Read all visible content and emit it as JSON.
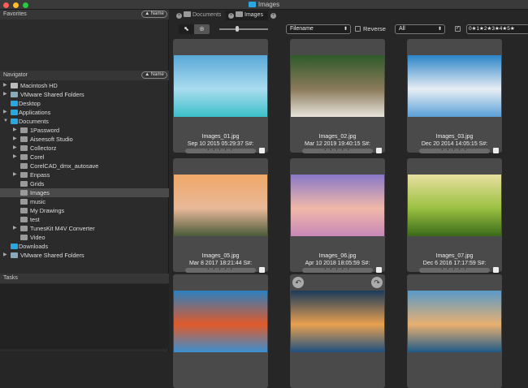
{
  "window": {
    "title": "Images"
  },
  "favorites": {
    "title": "Favorites",
    "sort_label": "▲ Name"
  },
  "navigator": {
    "title": "Navigator",
    "sort_label": "▲ Name",
    "items": [
      {
        "label": "Macintosh HD",
        "level": 0,
        "expander": true,
        "icon": "disk"
      },
      {
        "label": "VMware Shared Folders",
        "level": 0,
        "expander": true,
        "icon": "network"
      },
      {
        "label": "Desktop",
        "level": 0,
        "expander": false,
        "icon": "blue"
      },
      {
        "label": "Applications",
        "level": 0,
        "expander": true,
        "icon": "blue"
      },
      {
        "label": "Documents",
        "level": 0,
        "expander": true,
        "open": true,
        "icon": "blue"
      },
      {
        "label": "1Password",
        "level": 1,
        "expander": true,
        "icon": "gray"
      },
      {
        "label": "Aiseesoft Studio",
        "level": 1,
        "expander": true,
        "icon": "gray"
      },
      {
        "label": "Collectorz",
        "level": 1,
        "expander": true,
        "icon": "gray"
      },
      {
        "label": "Corel",
        "level": 1,
        "expander": true,
        "icon": "gray"
      },
      {
        "label": "CorelCAD_dmx_autosave",
        "level": 1,
        "expander": false,
        "icon": "gray"
      },
      {
        "label": "Enpass",
        "level": 1,
        "expander": true,
        "icon": "gray"
      },
      {
        "label": "Grids",
        "level": 1,
        "expander": false,
        "icon": "gray"
      },
      {
        "label": "Images",
        "level": 1,
        "expander": false,
        "icon": "gray",
        "selected": true
      },
      {
        "label": "music",
        "level": 1,
        "expander": false,
        "icon": "gray"
      },
      {
        "label": "My Drawings",
        "level": 1,
        "expander": false,
        "icon": "gray"
      },
      {
        "label": "test",
        "level": 1,
        "expander": false,
        "icon": "gray"
      },
      {
        "label": "TunesKit M4V Converter",
        "level": 1,
        "expander": true,
        "icon": "gray"
      },
      {
        "label": "Video",
        "level": 1,
        "expander": false,
        "icon": "gray"
      },
      {
        "label": "Downloads",
        "level": 0,
        "expander": false,
        "icon": "blue"
      },
      {
        "label": "VMware Shared Folders",
        "level": 0,
        "expander": true,
        "icon": "network"
      }
    ]
  },
  "tasks": {
    "title": "Tasks"
  },
  "tabs": [
    {
      "label": "Documents",
      "active": false
    },
    {
      "label": "Images",
      "active": true
    }
  ],
  "toolbar": {
    "sort_field": "Filename",
    "reverse_label": "Reverse",
    "filter": "All",
    "rating_filter": "0★1★2★3★4★5★"
  },
  "thumbnails": [
    {
      "name": "Images_01.jpg",
      "date": "Sep 10 2015 05:29:37 S#:",
      "rating": "• • • • •",
      "colors": [
        "#5aa8d8",
        "#a9dcef",
        "#3cc0c8"
      ]
    },
    {
      "name": "Images_02.jpg",
      "date": "Mar 12 2019 19:40:15 S#:",
      "rating": "• • • • •",
      "colors": [
        "#2f5a2a",
        "#8a7a5a",
        "#e8e4dc"
      ]
    },
    {
      "name": "Images_03.jpg",
      "date": "Dec 20 2014 14:05:15 S#:",
      "rating": "• • • • •",
      "colors": [
        "#2a84c8",
        "#e8eef4",
        "#5aa0d8"
      ]
    },
    {
      "name": "Images_05.jpg",
      "date": "Mar 8 2017 18:21:44 S#:",
      "rating": "• • • • •",
      "colors": [
        "#f0a868",
        "#e8b898",
        "#4a5a3a"
      ]
    },
    {
      "name": "Images_06.jpg",
      "date": "Apr 10 2018 18:05:59 S#:",
      "rating": "• • • • •",
      "colors": [
        "#8a78c8",
        "#f0b8a8",
        "#c888b8"
      ]
    },
    {
      "name": "Images_07.jpg",
      "date": "Dec 6 2016 17:17:59 S#:",
      "rating": "• • • • •",
      "colors": [
        "#e8e0a0",
        "#9ac040",
        "#3a6a1a"
      ]
    },
    {
      "name": "",
      "date": "",
      "rating": "",
      "colors": [
        "#2a80c0",
        "#e05a2a",
        "#3a90d0"
      ]
    },
    {
      "name": "",
      "date": "",
      "rating": "",
      "colors": [
        "#1a3a5a",
        "#e8a050",
        "#1e5080"
      ]
    },
    {
      "name": "",
      "date": "",
      "rating": "",
      "colors": [
        "#5a9ac8",
        "#e8b070",
        "#1e5a88"
      ]
    }
  ]
}
